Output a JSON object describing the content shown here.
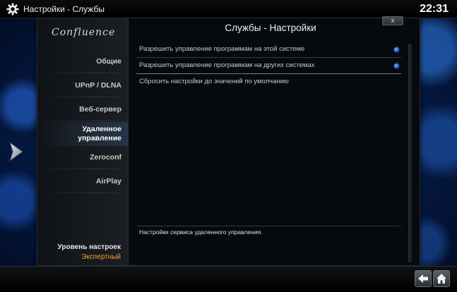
{
  "topbar": {
    "title": "Настройки - Службы",
    "clock": "22:31"
  },
  "dialog": {
    "logo": "Confluence",
    "title": "Службы - Настройки",
    "close_label": "x"
  },
  "sidebar": {
    "items": [
      {
        "label": "Общие"
      },
      {
        "label": "UPnP / DLNA"
      },
      {
        "label": "Веб-сервер"
      },
      {
        "label": "Удаленное управление",
        "active": true
      },
      {
        "label": "Zeroconf"
      },
      {
        "label": "AirPlay"
      }
    ],
    "level_label": "Уровень настроек",
    "level_value": "Экспертный"
  },
  "settings": [
    {
      "label": "Разрешить управление программам на этой системе",
      "enabled": true
    },
    {
      "label": "Разрешить управление программам на других системах",
      "enabled": true
    },
    {
      "label": "Сбросить настройки до значений по умолчанию"
    }
  ],
  "description": "Настройки сервиса удаленного управления.",
  "colors": {
    "accent": "#f0a020",
    "radio_on": "#2a64d8"
  },
  "icons": {
    "topbar": "gear-icon",
    "back": "back-arrow-icon",
    "home": "home-icon",
    "side": "pointer-arrow-icon"
  }
}
